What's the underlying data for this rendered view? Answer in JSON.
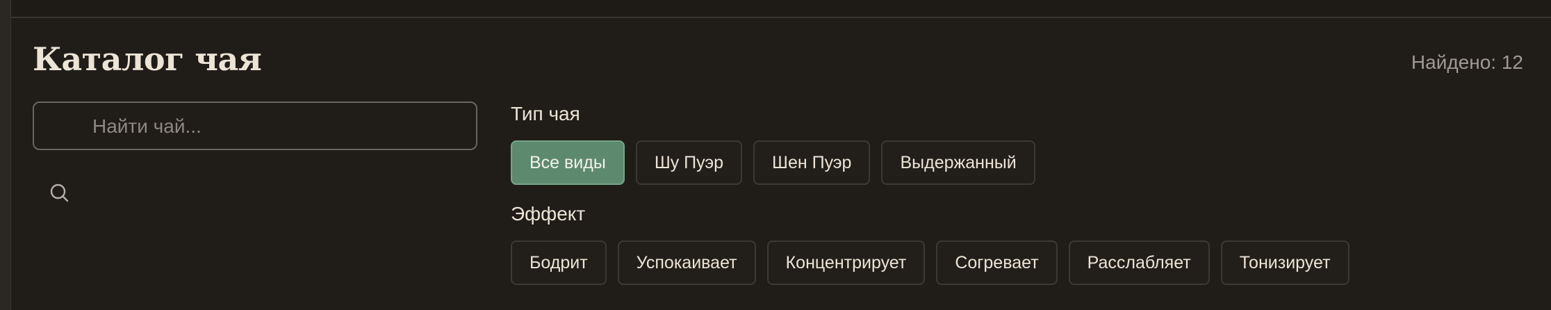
{
  "header": {
    "title": "Каталог чая",
    "found": "Найдено: 12"
  },
  "search": {
    "placeholder": "Найти чай...",
    "value": "",
    "icon": "search-icon"
  },
  "filters": {
    "tea_type": {
      "label": "Тип чая",
      "options": [
        "Все виды",
        "Шу Пуэр",
        "Шен Пуэр",
        "Выдержанный"
      ],
      "selected": "Все виды"
    },
    "effect": {
      "label": "Эффект",
      "options": [
        "Бодрит",
        "Успокаивает",
        "Концентрирует",
        "Согревает",
        "Расслабляет",
        "Тонизирует"
      ]
    }
  },
  "colors": {
    "background": "#201d19",
    "accent": "#5d8a6e",
    "text": "#ece4d6",
    "muted": "#a09a92"
  }
}
